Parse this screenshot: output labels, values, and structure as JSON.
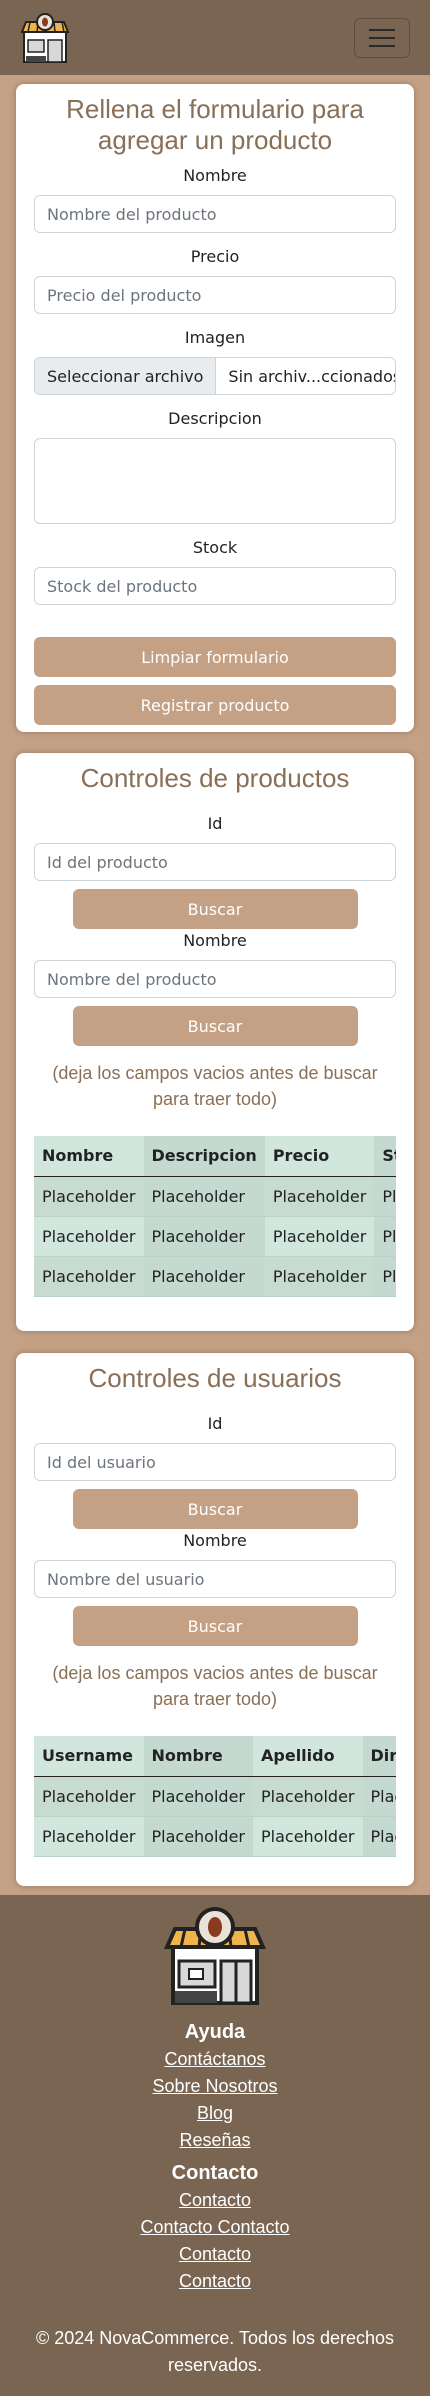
{
  "navbar": {
    "logo_icon": "store-coffee-logo-icon",
    "toggler_icon": "hamburger-menu-icon"
  },
  "product_form": {
    "title": "Rellena el formulario para agregar un producto",
    "name_label": "Nombre",
    "name_placeholder": "Nombre del producto",
    "price_label": "Precio",
    "price_placeholder": "Precio del producto",
    "image_label": "Imagen",
    "file_button": "Seleccionar archivo",
    "file_status": "Sin archiv...ccionados",
    "description_label": "Descripcion",
    "stock_label": "Stock",
    "stock_placeholder": "Stock del producto",
    "clear_button": "Limpiar formulario",
    "submit_button": "Registrar producto"
  },
  "product_controls": {
    "title": "Controles de productos",
    "id_label": "Id",
    "id_placeholder": "Id del producto",
    "search_id_button": "Buscar",
    "name_label": "Nombre",
    "name_placeholder": "Nombre del producto",
    "search_name_button": "Buscar",
    "hint": "(deja los campos vacios antes de buscar para traer todo)",
    "table": {
      "headers": [
        "Nombre",
        "Descripcion",
        "Precio",
        "Stock"
      ],
      "rows": [
        [
          "Placeholder",
          "Placeholder",
          "Placeholder",
          "Placeholder"
        ],
        [
          "Placeholder",
          "Placeholder",
          "Placeholder",
          "Placeholder"
        ],
        [
          "Placeholder",
          "Placeholder",
          "Placeholder",
          "Placeholder"
        ]
      ]
    }
  },
  "user_controls": {
    "title": "Controles de usuarios",
    "id_label": "Id",
    "id_placeholder": "Id del usuario",
    "search_id_button": "Buscar",
    "name_label": "Nombre",
    "name_placeholder": "Nombre del usuario",
    "search_name_button": "Buscar",
    "hint": "(deja los campos vacios antes de buscar para traer todo)",
    "table": {
      "headers": [
        "Username",
        "Nombre",
        "Apellido",
        "Direccion"
      ],
      "rows": [
        [
          "Placeholder",
          "Placeholder",
          "Placeholder",
          "Placeholder"
        ],
        [
          "Placeholder",
          "Placeholder",
          "Placeholder",
          "Placeholder"
        ]
      ]
    }
  },
  "footer": {
    "help_heading": "Ayuda",
    "help_links": [
      "Contáctanos",
      "Sobre Nosotros",
      "Blog",
      "Reseñas"
    ],
    "contact_heading": "Contacto",
    "contact_links": [
      "Contacto",
      "Contacto Contacto",
      "Contacto",
      "Contacto"
    ],
    "copyright": "© 2024 NovaCommerce. Todos los derechos reservados."
  },
  "colors": {
    "accent": "#c4a084",
    "nav": "#7a6552",
    "title": "#8a6f57",
    "table": "#d1e7dd"
  }
}
